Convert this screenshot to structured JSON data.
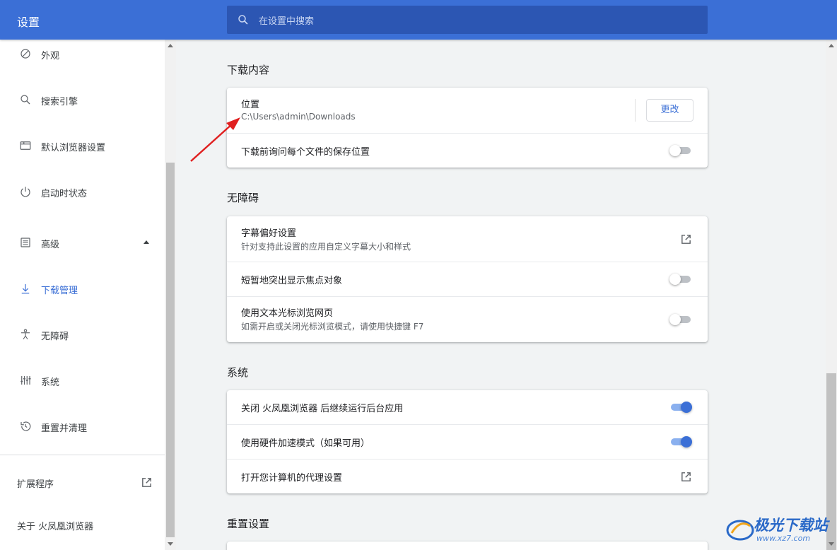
{
  "header": {
    "title": "设置",
    "search_placeholder": "在设置中搜索"
  },
  "sidebar": {
    "items": [
      {
        "label": "外观",
        "icon": "palette-icon"
      },
      {
        "label": "搜索引擎",
        "icon": "search-icon"
      },
      {
        "label": "默认浏览器设置",
        "icon": "browser-icon"
      },
      {
        "label": "启动时状态",
        "icon": "power-icon"
      },
      {
        "label": "高级",
        "icon": "advanced-icon"
      },
      {
        "label": "下载管理",
        "icon": "download-icon"
      },
      {
        "label": "无障碍",
        "icon": "accessibility-icon"
      },
      {
        "label": "系统",
        "icon": "tune-icon"
      },
      {
        "label": "重置并清理",
        "icon": "restore-icon"
      }
    ],
    "active_label": "下载管理",
    "extensions_label": "扩展程序",
    "about_label": "关于 火凤凰浏览器"
  },
  "downloads": {
    "title": "下载内容",
    "location_label": "位置",
    "location_value": "C:\\Users\\admin\\Downloads",
    "change_button": "更改",
    "ask_label": "下载前询问每个文件的保存位置",
    "ask_enabled": false
  },
  "accessibility": {
    "title": "无障碍",
    "caption_label": "字幕偏好设置",
    "caption_sub": "针对支持此设置的应用自定义字幕大小和样式",
    "focus_label": "短暂地突出显示焦点对象",
    "focus_enabled": false,
    "caret_label": "使用文本光标浏览网页",
    "caret_sub": "如需开启或关闭光标浏览模式，请使用快捷键 F7",
    "caret_enabled": false
  },
  "system": {
    "title": "系统",
    "background_label": "关闭 火凤凰浏览器 后继续运行后台应用",
    "background_enabled": true,
    "hardware_label": "使用硬件加速模式（如果可用）",
    "hardware_enabled": true,
    "proxy_label": "打开您计算机的代理设置"
  },
  "reset": {
    "title": "重置设置"
  },
  "watermark": {
    "name": "极光下载站",
    "url": "www.xz7.com"
  },
  "colors": {
    "accent": "#3b6fd6",
    "header": "#3b6fd6",
    "annotation_arrow": "#e02020"
  }
}
